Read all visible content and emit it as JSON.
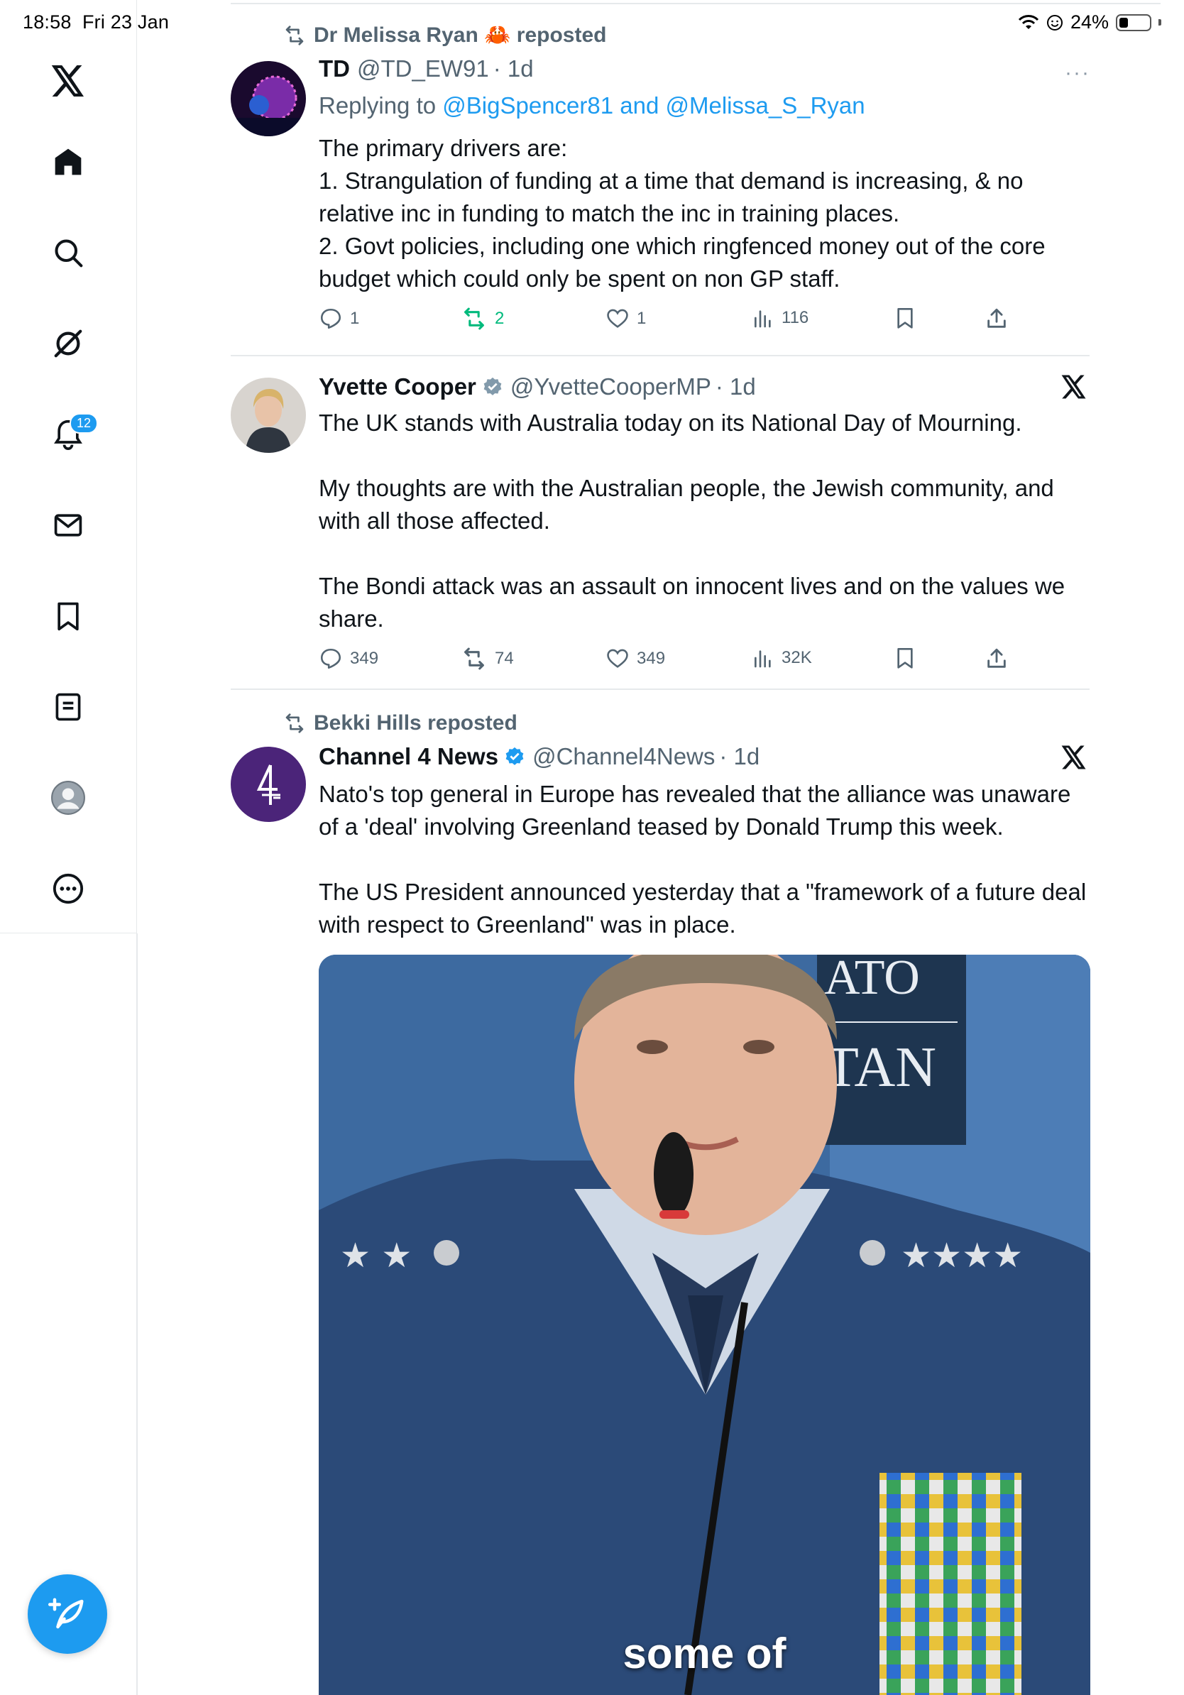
{
  "status": {
    "time": "18:58",
    "date": "Fri 23 Jan",
    "battery": "24%"
  },
  "sidebar": {
    "items": [
      {
        "id": "x-logo",
        "icon": "x-logo-icon"
      },
      {
        "id": "home",
        "icon": "home-icon"
      },
      {
        "id": "explore",
        "icon": "search-icon"
      },
      {
        "id": "grok",
        "icon": "grok-icon"
      },
      {
        "id": "notifications",
        "icon": "bell-icon",
        "badge": "12"
      },
      {
        "id": "messages",
        "icon": "mail-icon"
      },
      {
        "id": "bookmarks",
        "icon": "bookmark-icon"
      },
      {
        "id": "lists",
        "icon": "list-icon"
      },
      {
        "id": "profile",
        "icon": "avatar-icon"
      },
      {
        "id": "more",
        "icon": "more-circle-icon"
      }
    ],
    "compose_icon": "compose-icon"
  },
  "tweets": [
    {
      "repost_label": "Dr Melissa Ryan 🦀 reposted",
      "name": "TD",
      "handle": "@TD_EW91",
      "time": "· 1d",
      "replying_prefix": "Replying to",
      "replying_mentions": "@BigSpencer81 and @Melissa_S_Ryan",
      "text": "The primary drivers are:\n1. Strangulation of funding at a time that demand is increasing, & no relative inc in funding to match the inc in training places.\n2. Govt policies, including one which ringfenced money out of the core budget which could only be spent on non GP staff.",
      "replies": "1",
      "reposts": "2",
      "likes": "1",
      "views": "116",
      "more": "···"
    },
    {
      "name": "Yvette Cooper",
      "handle": "@YvetteCooperMP",
      "time": "· 1d",
      "text": "The UK stands with Australia today on its National Day of Mourning.\n\nMy thoughts are with the Australian people, the Jewish community, and with all those affected.\n\nThe Bondi attack was an assault on innocent lives and on the values we share.",
      "replies": "349",
      "reposts": "74",
      "likes": "349",
      "views": "32K"
    },
    {
      "repost_label": "Bekki Hills reposted",
      "name": "Channel 4 News",
      "handle": "@Channel4News",
      "time": "· 1d",
      "text": "Nato's top general in Europe has revealed that the alliance was unaware of a 'deal' involving Greenland teased by Donald Trump this week.\n\nThe US President announced yesterday that a \"framework of a future deal with respect to Greenland\" was in place.",
      "media_caption": "some of",
      "media_sign_top": "ATO",
      "media_sign_bottom": "TAN"
    }
  ],
  "colors": {
    "accent": "#1d9bf0",
    "muted": "#536471",
    "repost_green": "#00ba7c",
    "channel4_purple": "#4b2479"
  }
}
